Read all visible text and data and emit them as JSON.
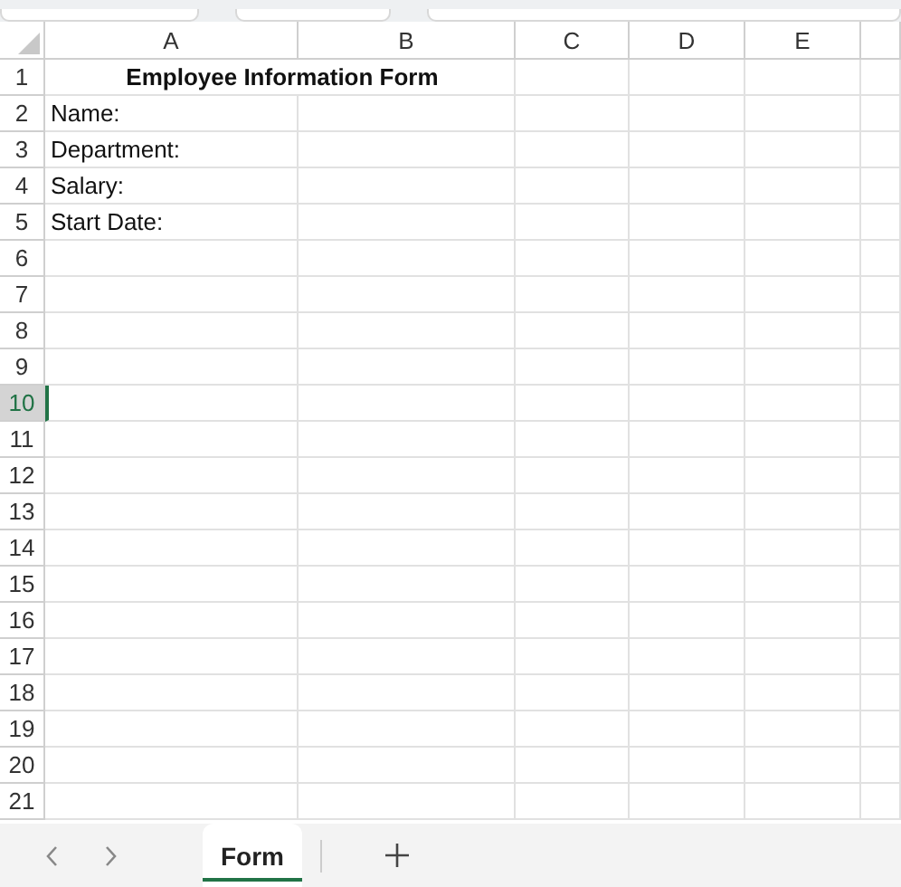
{
  "columns": [
    {
      "label": "A"
    },
    {
      "label": "B"
    },
    {
      "label": "C"
    },
    {
      "label": "D"
    },
    {
      "label": "E"
    }
  ],
  "rows": [
    {
      "label": "1",
      "selected": false,
      "kind": "title",
      "text": "Employee Information Form"
    },
    {
      "label": "2",
      "selected": false,
      "kind": "field",
      "text": "Name:"
    },
    {
      "label": "3",
      "selected": false,
      "kind": "field",
      "text": "Department:"
    },
    {
      "label": "4",
      "selected": false,
      "kind": "field",
      "text": "Salary:"
    },
    {
      "label": "5",
      "selected": false,
      "kind": "field",
      "text": "Start Date:"
    },
    {
      "label": "6",
      "selected": false,
      "kind": "empty"
    },
    {
      "label": "7",
      "selected": false,
      "kind": "empty"
    },
    {
      "label": "8",
      "selected": false,
      "kind": "empty"
    },
    {
      "label": "9",
      "selected": false,
      "kind": "empty"
    },
    {
      "label": "10",
      "selected": true,
      "kind": "empty"
    },
    {
      "label": "11",
      "selected": false,
      "kind": "empty"
    },
    {
      "label": "12",
      "selected": false,
      "kind": "empty"
    },
    {
      "label": "13",
      "selected": false,
      "kind": "empty"
    },
    {
      "label": "14",
      "selected": false,
      "kind": "empty"
    },
    {
      "label": "15",
      "selected": false,
      "kind": "empty"
    },
    {
      "label": "16",
      "selected": false,
      "kind": "empty"
    },
    {
      "label": "17",
      "selected": false,
      "kind": "empty"
    },
    {
      "label": "18",
      "selected": false,
      "kind": "empty"
    },
    {
      "label": "19",
      "selected": false,
      "kind": "empty"
    },
    {
      "label": "20",
      "selected": false,
      "kind": "empty"
    },
    {
      "label": "21",
      "selected": false,
      "kind": "empty"
    }
  ],
  "sheet_tabs": [
    {
      "label": "Form",
      "selected": true
    }
  ]
}
